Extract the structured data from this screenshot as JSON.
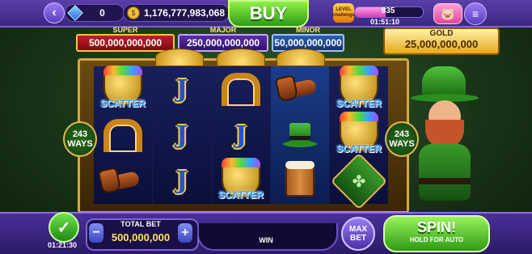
{
  "topbar": {
    "gems": "0",
    "coins": "1,176,777,983,068",
    "buy_label": "BUY",
    "level_label": "LEVEL challenge",
    "level_value": "935",
    "level_progress": 0.45,
    "level_timer": "01:51:10"
  },
  "jackpots": {
    "super_label": "SUPER",
    "super_value": "500,000,000,000",
    "major_label": "MAJOR",
    "major_value": "250,000,000,000",
    "minor_label": "MINOR",
    "minor_value": "50,000,000,000",
    "gold_label": "GOLD",
    "gold_value": "25,000,000,000"
  },
  "ways": {
    "left": "243 WAYS",
    "right": "243 WAYS"
  },
  "reels": [
    [
      "scatter",
      "horseshoe",
      "pipe"
    ],
    [
      "j",
      "j",
      "j"
    ],
    [
      "horseshoe",
      "j",
      "scatter"
    ],
    [
      "pipe",
      "hat",
      "mug"
    ],
    [
      "scatter",
      "scatter",
      "clover"
    ]
  ],
  "scatter_text": "SCATTER",
  "bottombar": {
    "auto_timer": "01:21:30",
    "total_bet_label": "TOTAL BET",
    "total_bet_value": "500,000,000",
    "minus": "−",
    "plus": "+",
    "win_label": "WIN",
    "max_bet_label": "MAX BET",
    "spin_label": "SPIN!",
    "spin_sub": "HOLD FOR AUTO"
  },
  "colors": {
    "accent_purple": "#4a2f99",
    "spin_green": "#2e9b14",
    "gold": "#e6a91c"
  }
}
